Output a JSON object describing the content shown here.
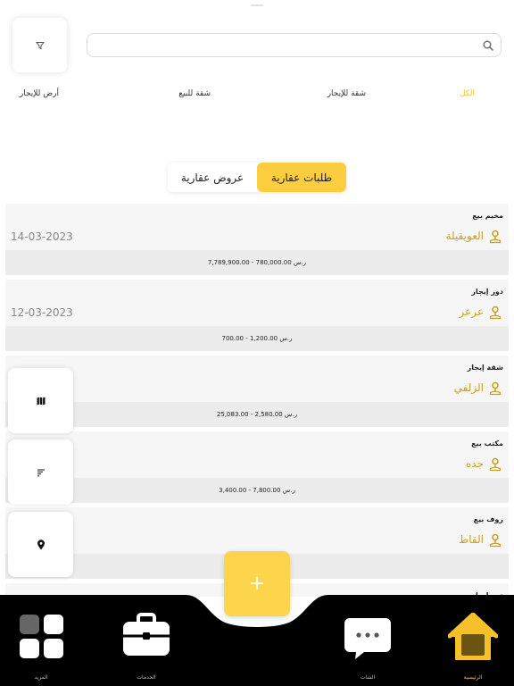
{
  "search": {
    "placeholder": ""
  },
  "categories": [
    {
      "label": "الكل",
      "active": true
    },
    {
      "label": "شقة للإيجار",
      "active": false
    },
    {
      "label": "شقة للبيع",
      "active": false
    },
    {
      "label": "أرض للإيجار",
      "active": false
    }
  ],
  "segment": {
    "requests_label": "طلبات عقارية",
    "offers_label": "عروض عقارية"
  },
  "listings": [
    {
      "type": "مخيم بيع",
      "city": "العويقيلة",
      "date": "14-03-2023",
      "price": "7,789,900.00 - 780,000.00 ر.س"
    },
    {
      "type": "دور إيجار",
      "city": "عرعر",
      "date": "12-03-2023",
      "price": "700.00 - 1,200.00 ر.س"
    },
    {
      "type": "شقة إيجار",
      "city": "الزلفي",
      "date": "",
      "price": "25,083.00 - 2,580.00 ر.س"
    },
    {
      "type": "مكتب بيع",
      "city": "جده",
      "date": "",
      "price": "3,400.00 - 7,800.00 ر.س"
    },
    {
      "type": "روف بيع",
      "city": "القاط",
      "date": "",
      "price": ""
    },
    {
      "type": "دور إيجار",
      "city": "",
      "date": "",
      "price": ""
    }
  ],
  "fab": {
    "label": "+"
  },
  "tabs": {
    "home": "الرئيسية",
    "chats": "الشات",
    "services": "الخدمات",
    "more": "المزيد"
  },
  "colors": {
    "accent": "#fccd3e",
    "accent_text": "#c9a11c",
    "tabbar": "#000000",
    "card_bg": "#f6f6f6"
  }
}
